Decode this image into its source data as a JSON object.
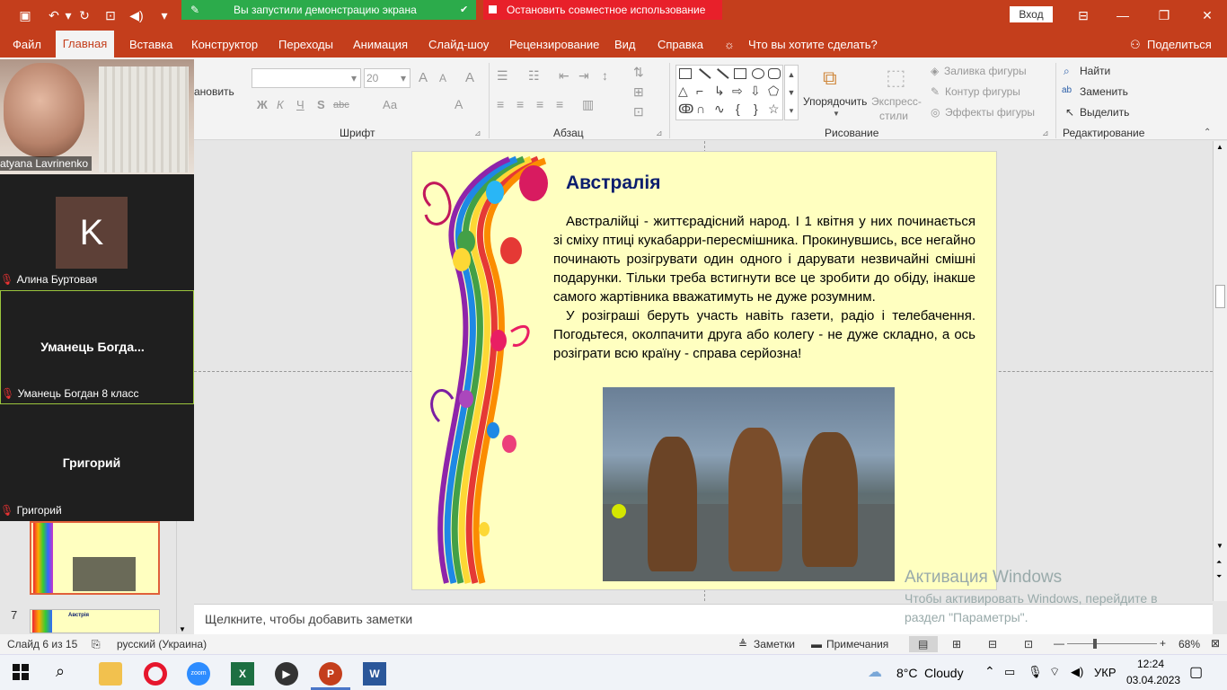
{
  "quick_access": {
    "save_icon": "save-icon",
    "undo_icon": "undo-icon",
    "redo_icon": "redo-icon",
    "present_icon": "present-icon",
    "volume_icon": "volume-icon",
    "customize_icon": "chevron-down-icon"
  },
  "share_banner": {
    "text": "Вы запустили демонстрацию экрана",
    "stop_label": "Остановить совместное использование"
  },
  "window": {
    "login_label": "Вход"
  },
  "menu": {
    "file": "Файл",
    "home": "Главная",
    "insert": "Вставка",
    "design": "Конструктор",
    "transitions": "Переходы",
    "animation": "Анимация",
    "slideshow": "Слайд-шоу",
    "review": "Рецензирование",
    "view": "Вид",
    "help": "Справка",
    "tell_me": "Что вы хотите сделать?",
    "share": "Поделиться"
  },
  "ribbon": {
    "font_size": "20",
    "bold": "Ж",
    "italic": "К",
    "underline": "Ч",
    "shadow": "S",
    "strike": "abc",
    "case": "Аа",
    "grow": "A",
    "shrink": "A",
    "clear": "A",
    "reset_partial": "ановить",
    "arrange": "Упорядочить",
    "quick_styles": "Экспресс-",
    "quick_styles2": "стили",
    "shape_fill": "Заливка фигуры",
    "shape_outline": "Контур фигуры",
    "shape_effects": "Эффекты фигуры",
    "find": "Найти",
    "replace": "Заменить",
    "select": "Выделить",
    "group_font": "Шрифт",
    "group_paragraph": "Абзац",
    "group_drawing": "Рисование",
    "group_editing": "Редактирование"
  },
  "zoom": {
    "participants": [
      {
        "name": "atyana Lavrinenko",
        "type": "video"
      },
      {
        "name": "Алина Буртовая",
        "avatar_letter": "K",
        "type": "avatar"
      },
      {
        "name": "Уманець Богдан 8 класс",
        "display": "Уманець Богда...",
        "type": "name"
      },
      {
        "name": "Григорий",
        "display": "Григорий",
        "type": "name"
      }
    ]
  },
  "thumbs": {
    "next_number": "7",
    "next_title": "Австрія"
  },
  "slide": {
    "title": "Австралія",
    "para1": "Австралійці - життєрадісний народ. І 1 квітня у них починається зі сміху птиці кукабарри-пересмішника. Прокинувшись, все негайно починають розігрувати один одного і дарувати незвичайні смішні подарунки. Тільки треба встигнути все це зробити до обіду, інакше самого жартівника вважатимуть не дуже розумним.",
    "para2": "У розіграші беруть участь навіть газети, радіо і телебачення. Погодьтеся, околпачити друга або колегу - не дуже складно, а ось розіграти всю країну - справа серйозна!"
  },
  "notes": {
    "placeholder": "Щелкните, чтобы добавить заметки"
  },
  "watermark": {
    "line1": "Активация Windows",
    "line2": "Чтобы активировать Windows, перейдите в",
    "line3": "раздел \"Параметры\"."
  },
  "status": {
    "slide_counter": "Слайд 6 из 15",
    "language": "русский (Украина)",
    "notes": "Заметки",
    "comments": "Примечания",
    "zoom": "68%"
  },
  "taskbar": {
    "weather_temp": "8°C",
    "weather_text": "Cloudy",
    "lang": "УКР",
    "time": "12:24",
    "date": "03.04.2023"
  },
  "colors": {
    "accent": "#c43e1c",
    "share_green": "#2cab4b",
    "stop_red": "#e8202a",
    "slide_bg": "#ffffc0",
    "title_blue": "#0b1d6e"
  }
}
